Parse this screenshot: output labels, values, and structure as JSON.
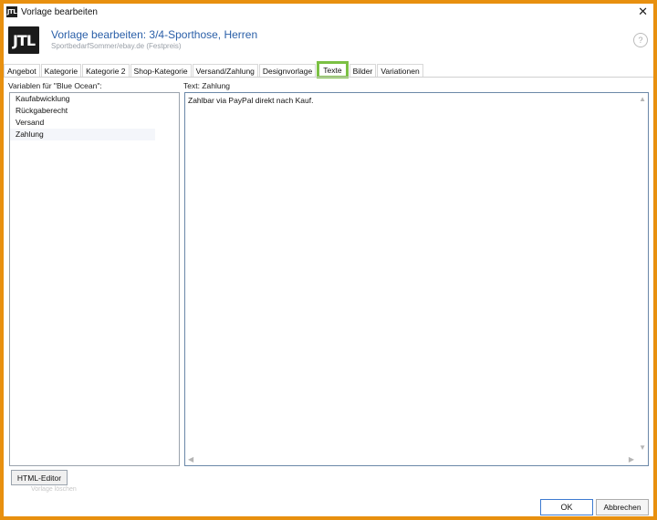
{
  "window": {
    "title": "Vorlage bearbeiten",
    "app_icon_text": "JTL",
    "close_glyph": "✕"
  },
  "header": {
    "logo_text": "JTL",
    "title": "Vorlage bearbeiten: 3/4-Sporthose, Herren",
    "subtitle": "SportbedarfSommer/ebay.de (Festpreis)",
    "help_glyph": "?"
  },
  "tabs": [
    {
      "label": "Angebot"
    },
    {
      "label": "Kategorie"
    },
    {
      "label": "Kategorie 2"
    },
    {
      "label": "Shop-Kategorie"
    },
    {
      "label": "Versand/Zahlung"
    },
    {
      "label": "Designvorlage"
    },
    {
      "label": "Texte",
      "active": true
    },
    {
      "label": "Bilder"
    },
    {
      "label": "Variationen"
    }
  ],
  "variables_label": "Variablen für \"Blue Ocean\":",
  "variables": [
    {
      "label": "Kaufabwicklung"
    },
    {
      "label": "Rückgaberecht"
    },
    {
      "label": "Versand"
    },
    {
      "label": "Zahlung",
      "selected": true
    }
  ],
  "text_label": "Text: Zahlung",
  "text_content": "Zahlbar via PayPal direkt nach Kauf.",
  "buttons": {
    "html_editor": "HTML-Editor",
    "ok": "OK",
    "cancel": "Abbrechen"
  },
  "faint_text": "Vorlage löschen",
  "colors": {
    "frame": "#e8900f",
    "active_tab_highlight": "#7bc043",
    "heading": "#2a5fa8"
  }
}
